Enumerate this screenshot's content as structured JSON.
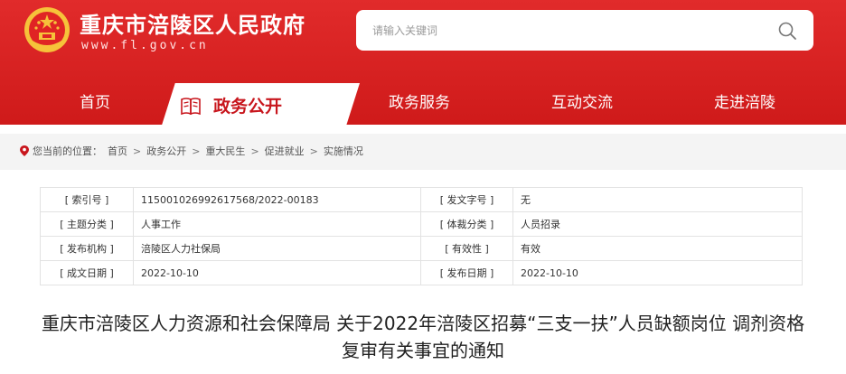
{
  "header": {
    "site_title": "重庆市涪陵区人民政府",
    "site_url": "www.fl.gov.cn",
    "emblem_icon": "national-emblem-icon",
    "colors": {
      "brand_red": "#d52020",
      "active_red": "#c8161d"
    }
  },
  "search": {
    "placeholder": "请输入关键词",
    "icon": "search-icon"
  },
  "nav": {
    "items": [
      {
        "label": "首页"
      },
      {
        "label": "政务公开",
        "active": true,
        "icon": "book-icon"
      },
      {
        "label": "政务服务"
      },
      {
        "label": "互动交流"
      },
      {
        "label": "走进涪陵"
      }
    ]
  },
  "breadcrumb": {
    "prefix": "您当前的位置：",
    "items": [
      "首页",
      "政务公开",
      "重大民生",
      "促进就业",
      "实施情况"
    ],
    "separator": ">",
    "icon": "location-pin-icon"
  },
  "meta": {
    "rows": [
      [
        "[ 索引号 ]",
        "11500102699261​7568/2022-00183",
        "[ 发文字号 ]",
        "无"
      ],
      [
        "[ 主题分类 ]",
        "人事工作",
        "[ 体裁分类 ]",
        "人员招录"
      ],
      [
        "[ 发布机构 ]",
        "涪陵区人力社保局",
        "[ 有效性 ]",
        "有效"
      ],
      [
        "[ 成文日期 ]",
        "2022-10-10",
        "[ 发布日期 ]",
        "2022-10-10"
      ]
    ]
  },
  "doc": {
    "title": "重庆市涪陵区人力资源和社会保障局 关于2022年涪陵区招募“三支一扶”人员缺额岗位 调剂资格复审有关事宜的通知"
  }
}
